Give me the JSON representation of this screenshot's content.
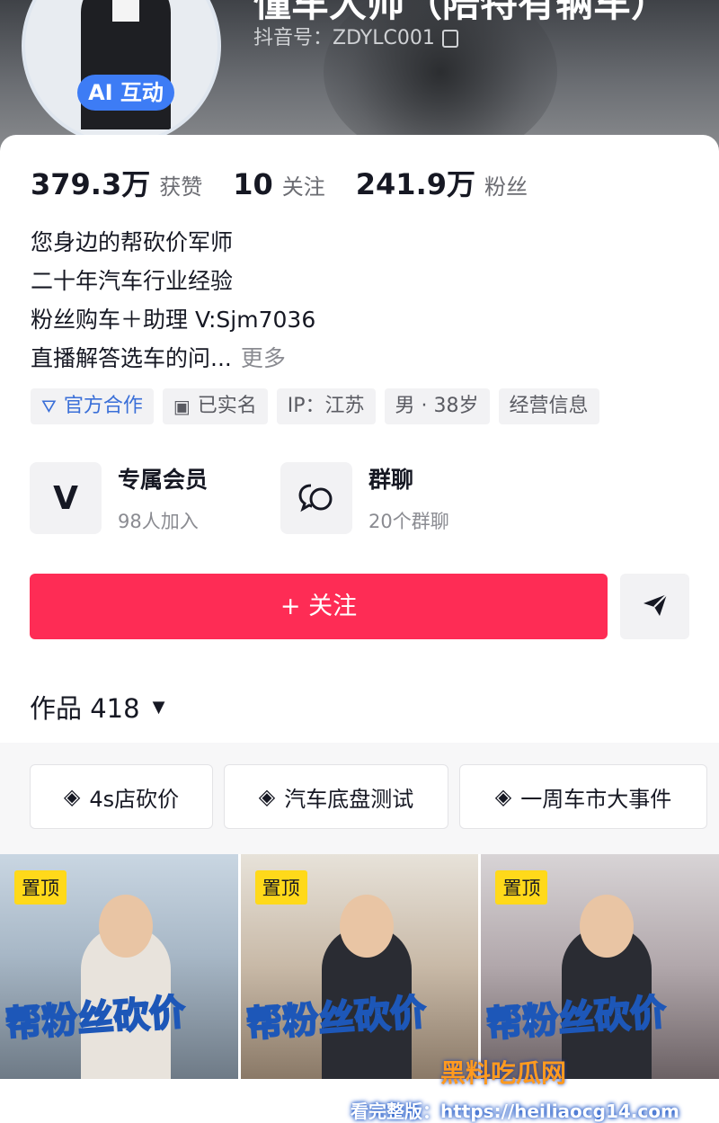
{
  "header": {
    "username": "懂车大帅（陪特有辆车）",
    "douyin_id": "抖音号：ZDYLC001",
    "ai_badge": "AI 互动"
  },
  "stats": [
    {
      "value": "379.3万",
      "label": "获赞"
    },
    {
      "value": "10",
      "label": "关注"
    },
    {
      "value": "241.9万",
      "label": "粉丝"
    }
  ],
  "bio": {
    "lines": [
      "您身边的帮砍价军师",
      "二十年汽车行业经验",
      "粉丝购车＋助理 V:Sjm7036",
      "直播解答选车的问..."
    ],
    "more": "更多"
  },
  "tags": [
    {
      "label": "官方合作",
      "icon": "official-icon"
    },
    {
      "label": "已实名",
      "icon": "id-card-icon"
    },
    {
      "label": "IP：江苏"
    },
    {
      "label": "男 · 38岁"
    },
    {
      "label": "经营信息"
    }
  ],
  "features": {
    "member": {
      "title": "专属会员",
      "subtitle": "98人加入",
      "icon": "vip-icon"
    },
    "group": {
      "title": "群聊",
      "subtitle": "20个群聊",
      "icon": "chat-icon"
    }
  },
  "actions": {
    "follow": "+ 关注",
    "share_icon": "share-icon"
  },
  "works": {
    "label": "作品 418"
  },
  "collections": [
    {
      "label": "4s店砍价",
      "icon": "collection-icon"
    },
    {
      "label": "汽车底盘测试",
      "icon": "collection-icon"
    },
    {
      "label": "一周车市大事件",
      "icon": "collection-icon"
    }
  ],
  "videos": [
    {
      "pin": "置顶",
      "title": "帮粉丝砍价"
    },
    {
      "pin": "置顶",
      "title": "帮粉丝砍价"
    },
    {
      "pin": "置顶",
      "title": "帮粉丝砍价"
    }
  ],
  "watermark": {
    "brand": "黑料吃瓜网",
    "text": "看完整版：https://heiliaocg14.com"
  },
  "colors": {
    "follow": "#fe2c55",
    "accent_blue": "#3d7cf5",
    "pin": "#ffd91a"
  }
}
